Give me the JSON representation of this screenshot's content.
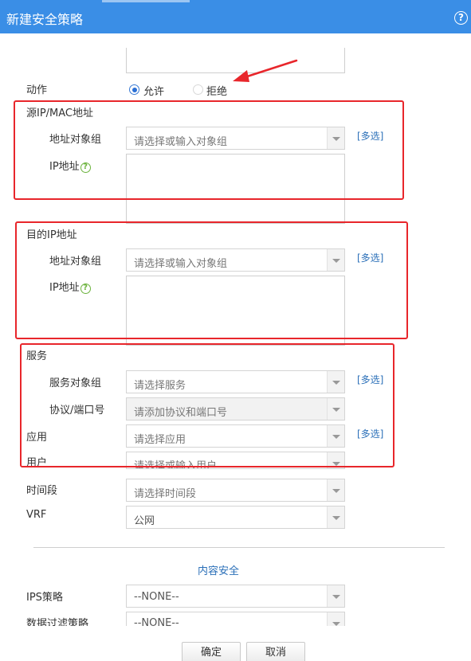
{
  "window": {
    "title": "新建安全策略",
    "help_icon": "?"
  },
  "action": {
    "label": "动作",
    "options": [
      {
        "label": "允许",
        "selected": true
      },
      {
        "label": "拒绝",
        "selected": false
      }
    ]
  },
  "source": {
    "section_label": "源IP/MAC地址",
    "address_group_label": "地址对象组",
    "address_group_placeholder": "请选择或输入对象组",
    "multi_label": "[多选]",
    "ip_label": "IP地址",
    "help_glyph": "?"
  },
  "destination": {
    "section_label": "目的IP地址",
    "address_group_label": "地址对象组",
    "address_group_placeholder": "请选择或输入对象组",
    "multi_label": "[多选]",
    "ip_label": "IP地址",
    "help_glyph": "?"
  },
  "service": {
    "section_label": "服务",
    "object_group_label": "服务对象组",
    "object_group_placeholder": "请选择服务",
    "multi_label": "[多选]",
    "protocol_port_label": "协议/端口号",
    "protocol_port_placeholder": "请添加协议和端口号"
  },
  "application": {
    "label": "应用",
    "placeholder": "请选择应用",
    "multi_label": "[多选]"
  },
  "user": {
    "label": "用户",
    "placeholder": "请选择或输入用户"
  },
  "time_range": {
    "label": "时间段",
    "placeholder": "请选择时间段"
  },
  "vrf": {
    "label": "VRF",
    "value": "公网"
  },
  "content_security": {
    "heading": "内容安全",
    "ips_label": "IPS策略",
    "ips_value": "--NONE--",
    "data_filter_label": "数据过滤策略",
    "data_filter_value": "--NONE--"
  },
  "footer": {
    "ok_label": "确定",
    "cancel_label": "取消"
  },
  "colors": {
    "title_bar": "#3a8ee6",
    "highlight_box": "#e8262b",
    "link": "#2a6fb8",
    "help_green": "#6cb33e"
  }
}
